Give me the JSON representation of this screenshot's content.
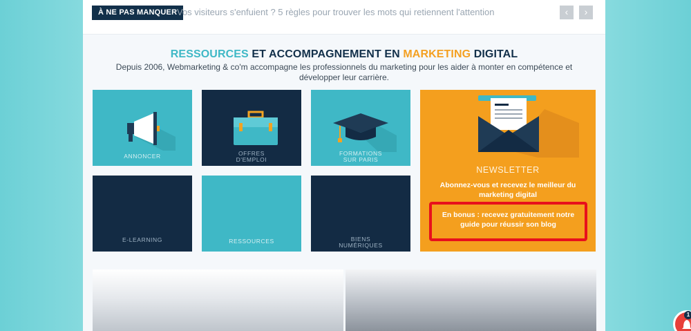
{
  "ticker": {
    "badge": "À NE PAS MANQUER",
    "text": "Vos visiteurs s'enfuient ? 5 règles pour trouver les mots qui retiennent l'attention",
    "prev": "‹",
    "next": "›"
  },
  "hero": {
    "title_part1": "RESSOURCES",
    "title_part2": " ET ACCOMPAGNEMENT EN ",
    "title_part3": "MARKETING",
    "title_part4": " DIGITAL",
    "description": "Depuis 2006, Webmarketing & co'm accompagne les professionnels du marketing pour les aider à monter en compétence et développer leur carrière."
  },
  "tiles": [
    {
      "label": "ANNONCER",
      "icon": "megaphone-icon"
    },
    {
      "label_line1": "OFFRES",
      "label_line2": "D'EMPLOI",
      "icon": "briefcase-icon"
    },
    {
      "label_line1": "FORMATIONS",
      "label_line2": "SUR PARIS",
      "icon": "graduation-cap-icon"
    },
    {
      "label": "E-LEARNING"
    },
    {
      "label": "RESSOURCES"
    },
    {
      "label_line1": "BIENS",
      "label_line2": "NUMÉRIQUES"
    }
  ],
  "newsletter": {
    "title": "NEWSLETTER",
    "subtitle": "Abonnez-vous et recevez le meilleur du marketing digital",
    "bonus": "En bonus : recevez gratuitement notre guide pour réussir son blog",
    "icon": "envelope-icon"
  },
  "notification": {
    "count": "1",
    "icon": "bell-icon"
  },
  "colors": {
    "teal": "#3fb8c6",
    "navy": "#132b44",
    "orange": "#f49f1e",
    "highlight": "#e8101c"
  }
}
